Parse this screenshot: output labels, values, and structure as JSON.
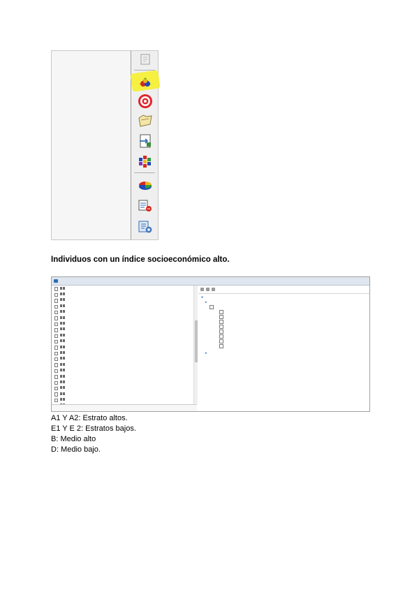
{
  "heading": "Individuos con un índice socioeconómico alto.",
  "toolbar": {
    "icons": [
      "select-icon",
      "segment-icon",
      "target-icon",
      "folder-icon",
      "export-icon",
      "matrix-icon",
      "pie-chart-icon",
      "report-icon",
      "settings-icon"
    ]
  },
  "tree_window": {
    "title": "",
    "tree_items": [
      {
        "label": "",
        "highlighted": false
      },
      {
        "label": "",
        "highlighted": false
      },
      {
        "label": "",
        "highlighted": false
      },
      {
        "label": "",
        "highlighted": false
      },
      {
        "label": "",
        "highlighted": false
      },
      {
        "label": "",
        "highlighted": false
      },
      {
        "label": "",
        "highlighted": false
      },
      {
        "label": "",
        "highlighted": false
      },
      {
        "label": "",
        "highlighted": false
      },
      {
        "label": "",
        "highlighted": false
      },
      {
        "label": "",
        "highlighted": false
      },
      {
        "label": "",
        "highlighted": false
      },
      {
        "label": "",
        "highlighted": false
      },
      {
        "label": "",
        "highlighted": false
      },
      {
        "label": "",
        "highlighted": false
      },
      {
        "label": "",
        "highlighted": false
      },
      {
        "label": "",
        "highlighted": false
      },
      {
        "label": "",
        "highlighted": false
      },
      {
        "label": "",
        "highlighted": false
      },
      {
        "label": "",
        "highlighted": true
      },
      {
        "label": "",
        "highlighted": false
      },
      {
        "label": "",
        "highlighted": false
      },
      {
        "label": "",
        "highlighted": false
      },
      {
        "label": "",
        "highlighted": false
      }
    ],
    "bottom_label": "",
    "right_panel": {
      "toolbar_label": "",
      "root_label": "",
      "segment_label": "",
      "variable_label": "",
      "categories": [
        "",
        "",
        "",
        "",
        "",
        "",
        "",
        ""
      ],
      "last_segment_label": ""
    }
  },
  "legend": {
    "line1": "A1 Y A2: Estrato altos.",
    "line2": "E1 Y E 2: Estratos bajos.",
    "line3": "B: Medio alto",
    "line4": "D: Medio bajo."
  },
  "colors": {
    "highlight": "#fff176",
    "accent_blue": "#2f6db5"
  }
}
